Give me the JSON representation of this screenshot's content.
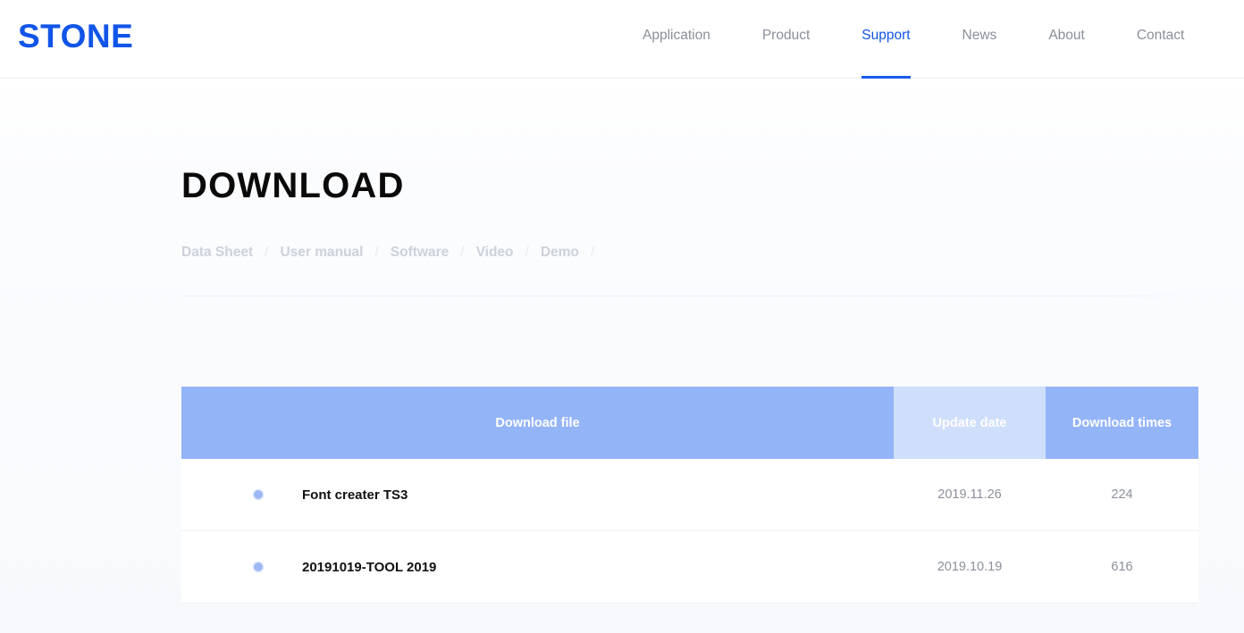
{
  "header": {
    "brand": "STONE",
    "brand_color": "#1155e8",
    "nav": [
      {
        "label": "Application",
        "active": false
      },
      {
        "label": "Product",
        "active": false
      },
      {
        "label": "Support",
        "active": true
      },
      {
        "label": "News",
        "active": false
      },
      {
        "label": "About",
        "active": false
      },
      {
        "label": "Contact",
        "active": false
      }
    ],
    "active_color": "#1a5ae8"
  },
  "main": {
    "title": "DOWNLOAD",
    "filters": [
      {
        "label": "Data Sheet"
      },
      {
        "label": "User manual"
      },
      {
        "label": "Software"
      },
      {
        "label": "Video"
      },
      {
        "label": "Demo"
      }
    ],
    "filter_separator": "/",
    "table": {
      "header_bg": "#94b4f8",
      "header_date_bg": "#cedefb",
      "columns": {
        "file": "Download file",
        "date": "Update date",
        "times": "Download times"
      },
      "rows": [
        {
          "icon": "circle-dot-icon",
          "name": "Font creater TS3",
          "date": "2019.11.26",
          "times": "224"
        },
        {
          "icon": "circle-dot-icon",
          "name": "20191019-TOOL 2019",
          "date": "2019.10.19",
          "times": "616"
        }
      ]
    }
  }
}
